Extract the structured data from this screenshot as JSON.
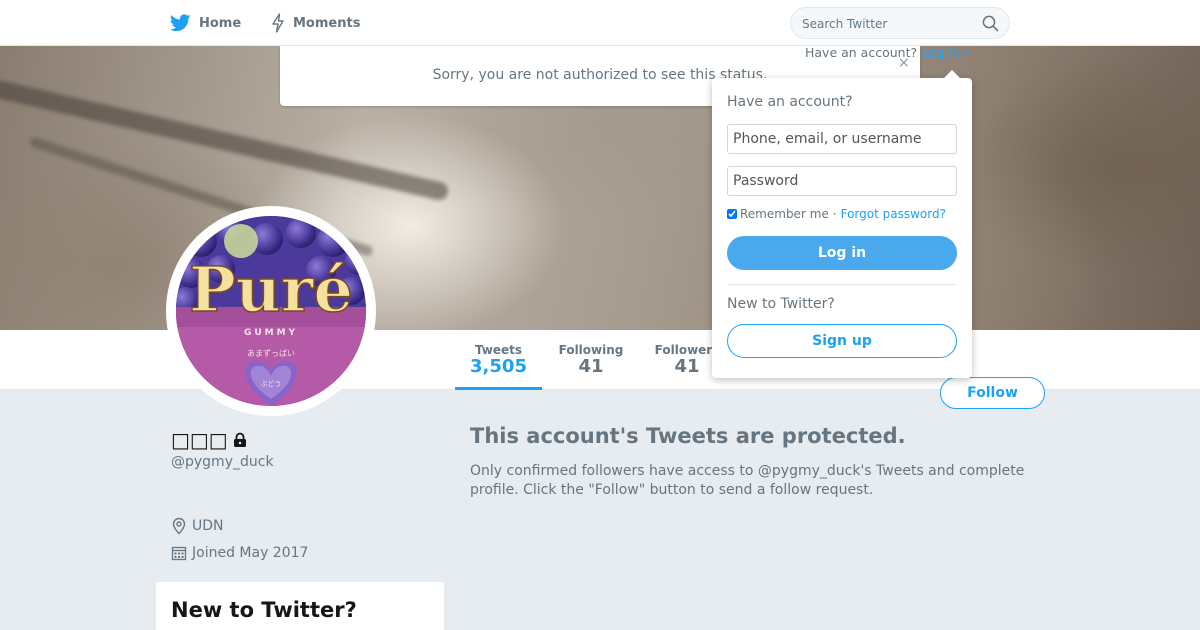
{
  "nav": {
    "home_label": "Home",
    "moments_label": "Moments",
    "search_placeholder": "Search Twitter"
  },
  "notice": {
    "text": "Sorry, you are not authorized to see this status.",
    "close_glyph": "×"
  },
  "login_menu": {
    "prompt": "Have an account?",
    "link_label": "Log in",
    "title": "Have an account?",
    "username_placeholder": "Phone, email, or username",
    "password_placeholder": "Password",
    "remember_label": "Remember me",
    "separator": "·",
    "forgot_label": "Forgot password?",
    "login_button": "Log in",
    "new_prompt": "New to Twitter?",
    "signup_button": "Sign up"
  },
  "avatar_art": {
    "brand": "Puré",
    "sub": "GUMMY",
    "tag": "あまずっぱい",
    "heart": "ぶどう"
  },
  "stats": {
    "tweets_label": "Tweets",
    "tweets_value": "3,505",
    "following_label": "Following",
    "following_value": "41",
    "followers_label": "Followers",
    "followers_value": "41"
  },
  "follow_button": "Follow",
  "profile": {
    "name": "□□□",
    "handle": "@pygmy_duck",
    "location": "UDN",
    "joined": "Joined May 2017"
  },
  "protected": {
    "title": "This account's Tweets are protected.",
    "description": "Only confirmed followers have access to @pygmy_duck's Tweets and complete profile. Click the \"Follow\" button to send a follow request."
  },
  "new_card": {
    "title": "New to Twitter?"
  },
  "colors": {
    "brand": "#1da1f2",
    "login_button": "#4aa8ec",
    "page_bg": "#e6ecf0"
  }
}
